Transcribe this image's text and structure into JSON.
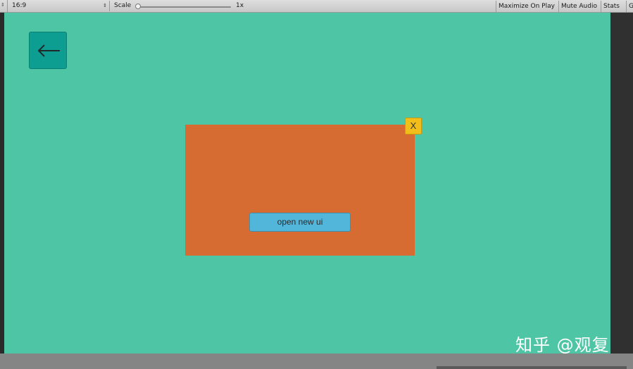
{
  "toolbar": {
    "aspect": "16:9",
    "scale_label": "Scale",
    "scale_value": "1x",
    "maximize_on_play": "Maximize On Play",
    "mute_audio": "Mute Audio",
    "stats": "Stats",
    "gizmos": "G"
  },
  "canvas": {
    "background_color": "#4ec5a4"
  },
  "back_button": {
    "icon": "arrow-left-icon",
    "color": "#0e9e91"
  },
  "panel": {
    "color": "#d76c33"
  },
  "close_button": {
    "label": "X",
    "color": "#f2bf1a"
  },
  "open_button": {
    "label": "open new ui",
    "color": "#52b6db"
  },
  "watermark": {
    "text": "知乎 @观复"
  }
}
